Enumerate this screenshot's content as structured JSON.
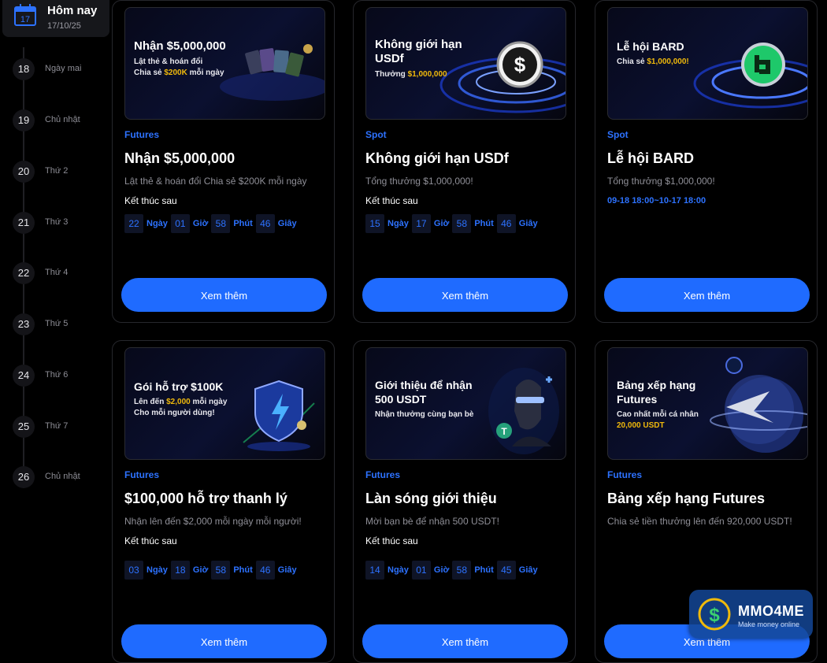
{
  "sidebar": {
    "today": {
      "title": "Hôm nay",
      "date": "17/10/25",
      "icon_number": "17"
    },
    "days": [
      {
        "num": "18",
        "label": "Ngày mai"
      },
      {
        "num": "19",
        "label": "Chủ nhật"
      },
      {
        "num": "20",
        "label": "Thứ 2"
      },
      {
        "num": "21",
        "label": "Thứ 3"
      },
      {
        "num": "22",
        "label": "Thứ 4"
      },
      {
        "num": "23",
        "label": "Thứ 5"
      },
      {
        "num": "24",
        "label": "Thứ 6"
      },
      {
        "num": "25",
        "label": "Thứ 7"
      },
      {
        "num": "26",
        "label": "Chủ nhật"
      }
    ]
  },
  "cards": [
    {
      "banner": {
        "title": "Nhận $5,000,000",
        "line1": "Lật thẻ & hoán đổi",
        "line2_pre": "Chia sẻ ",
        "line2_gold": "$200K",
        "line2_post": " mỗi ngày"
      },
      "category": "Futures",
      "title": "Nhận $5,000,000",
      "desc": "Lật thẻ & hoán đổi Chia sẻ $200K mỗi ngày",
      "ends_label": "Kết thúc sau",
      "countdown": {
        "d": "22",
        "h": "01",
        "m": "58",
        "s": "46"
      },
      "button": "Xem thêm"
    },
    {
      "banner": {
        "title": "Không giới hạn USDf",
        "line1_pre": "Thưởng ",
        "line1_gold": "$1,000,000"
      },
      "category": "Spot",
      "title": "Không giới hạn USDf",
      "desc": "Tổng thưởng $1,000,000!",
      "ends_label": "Kết thúc sau",
      "countdown": {
        "d": "15",
        "h": "17",
        "m": "58",
        "s": "46"
      },
      "button": "Xem thêm"
    },
    {
      "banner": {
        "title": "Lễ hội BARD",
        "line1_pre": "Chia sẻ ",
        "line1_gold": "$1,000,000!"
      },
      "category": "Spot",
      "title": "Lễ hội BARD",
      "desc": "Tổng thưởng $1,000,000!",
      "date_range": "09-18 18:00~10-17 18:00",
      "button": "Xem thêm"
    },
    {
      "banner": {
        "title": "Gói hỗ trợ $100K",
        "line1_pre": "Lên đến ",
        "line1_gold": "$2,000",
        "line1_post": " mỗi ngày",
        "line2": "Cho mỗi người dùng!"
      },
      "category": "Futures",
      "title": "$100,000 hỗ trợ thanh lý",
      "desc": "Nhận lên đến $2,000 mỗi ngày mỗi người!",
      "ends_label": "Kết thúc sau",
      "countdown": {
        "d": "03",
        "h": "18",
        "m": "58",
        "s": "46"
      },
      "button": "Xem thêm"
    },
    {
      "banner": {
        "title": "Giới thiệu để nhận 500 USDT",
        "line1": "Nhận thưởng cùng bạn bè"
      },
      "category": "Futures",
      "title": "Làn sóng giới thiệu",
      "desc": "Mời bạn bè để nhận 500 USDT!",
      "ends_label": "Kết thúc sau",
      "countdown": {
        "d": "14",
        "h": "01",
        "m": "58",
        "s": "45"
      },
      "button": "Xem thêm"
    },
    {
      "banner": {
        "title": "Bảng xếp hạng Futures",
        "line1": "Cao nhất mỗi cá nhân",
        "line2_gold": "20,000 USDT"
      },
      "category": "Futures",
      "title": "Bảng xếp hạng Futures",
      "desc": "Chia sẻ tiền thưởng lên đến 920,000 USDT!",
      "button": "Xem thêm"
    }
  ],
  "units": {
    "day": "Ngày",
    "hour": "Giờ",
    "minute": "Phút",
    "second": "Giây"
  },
  "watermark": {
    "brand": "MMO4ME",
    "tagline": "Make money online"
  },
  "colors": {
    "accent": "#1f6bff",
    "category": "#2d72ff",
    "gold": "#f0b90b",
    "background": "#000000"
  }
}
